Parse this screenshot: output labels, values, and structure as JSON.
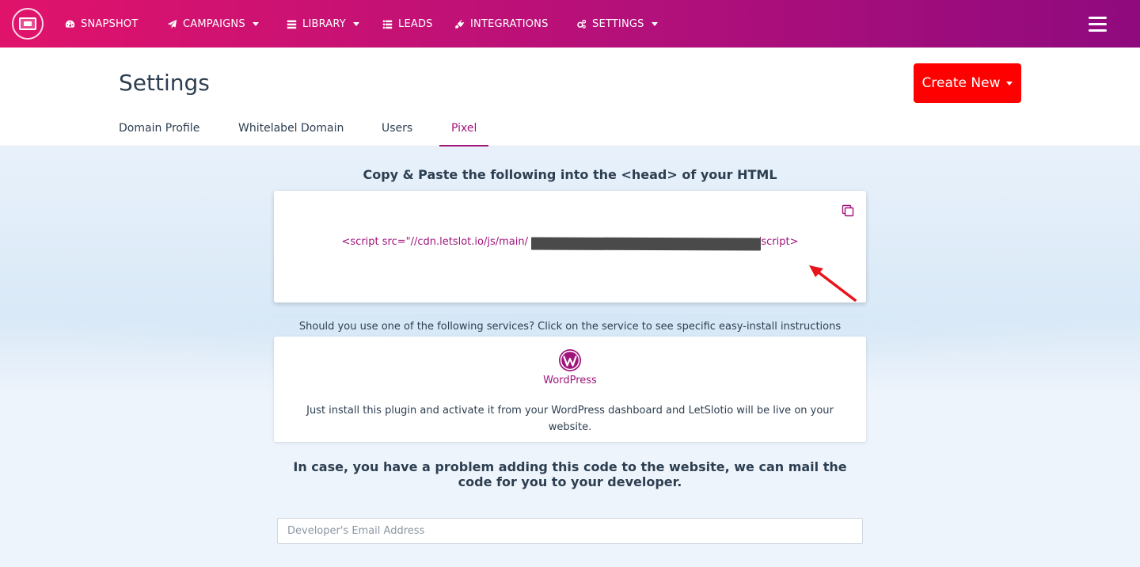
{
  "nav": {
    "items": [
      {
        "label": "SNAPSHOT",
        "icon": "dashboard-icon"
      },
      {
        "label": "CAMPAIGNS",
        "icon": "paper-plane-icon",
        "dropdown": true
      },
      {
        "label": "LIBRARY",
        "icon": "list-icon",
        "dropdown": true
      },
      {
        "label": "LEADS",
        "icon": "list-icon"
      },
      {
        "label": "INTEGRATIONS",
        "icon": "plug-icon"
      },
      {
        "label": "SETTINGS",
        "icon": "cogs-icon",
        "dropdown": true
      }
    ]
  },
  "header": {
    "title": "Settings",
    "create_label": "Create New",
    "tabs": [
      {
        "label": "Domain Profile"
      },
      {
        "label": "Whitelabel Domain"
      },
      {
        "label": "Users"
      },
      {
        "label": "Pixel",
        "active": true
      }
    ]
  },
  "pixel": {
    "instruction": "Copy & Paste the following into the <head> of your HTML",
    "code_prefix": "<script src=\"//cdn.letslot.io/js/main/",
    "code_suffix": "/script>",
    "services_prompt": "Should you use one of the following services? Click on the service to see specific easy-install instructions",
    "wordpress_label": "WordPress",
    "wordpress_desc": "Just install this plugin and activate it from your WordPress dashboard and LetSlotio will be live on your website.",
    "mail_title": "In case, you have a problem adding this code to the website, we can mail the code for you to your developer.",
    "email_placeholder": "Developer's Email Address"
  },
  "colors": {
    "brand_magenta": "#a0157c",
    "create_button": "#ff0000",
    "annotation_arrow": "#e8141b"
  }
}
